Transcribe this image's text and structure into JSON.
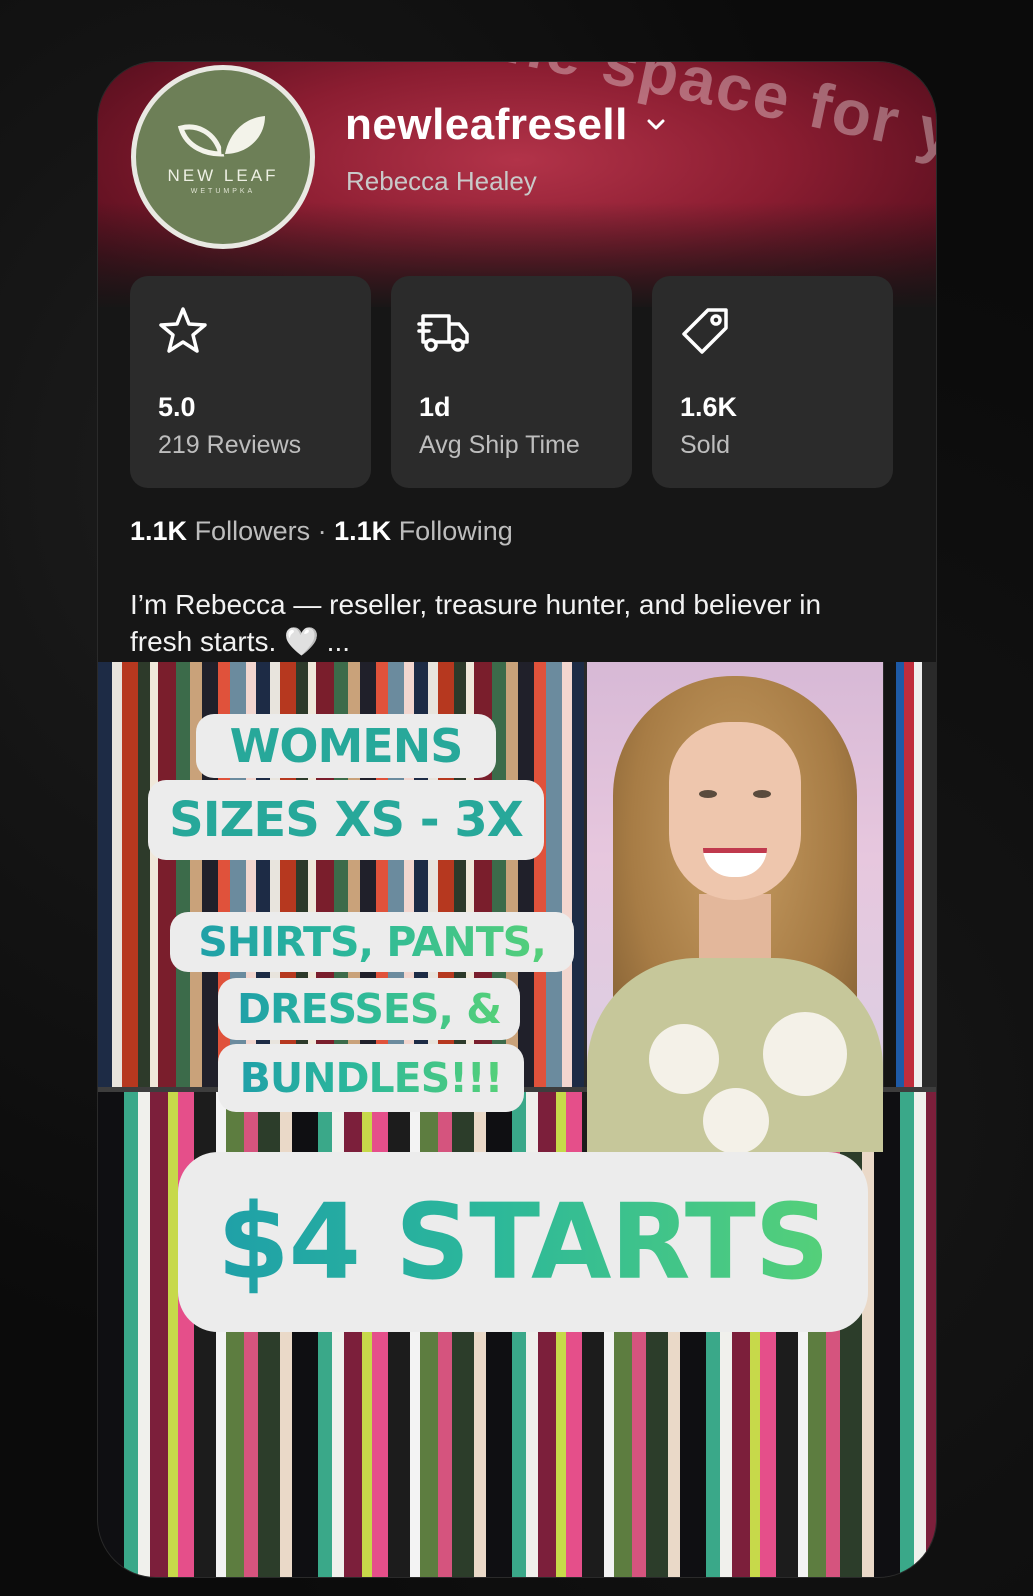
{
  "profile": {
    "username": "newleafresell",
    "real_name": "Rebecca Healey",
    "banner_text": "ice, an the space for you",
    "logo": {
      "line1": "NEW LEAF",
      "line2": "WETUMPKA"
    }
  },
  "stats": [
    {
      "icon": "star-icon",
      "value": "5.0",
      "label": "219 Reviews"
    },
    {
      "icon": "truck-icon",
      "value": "1d",
      "label": "Avg Ship Time"
    },
    {
      "icon": "tag-icon",
      "value": "1.6K",
      "label": "Sold"
    }
  ],
  "social": {
    "followers_count": "1.1K",
    "followers_label": "Followers",
    "separator": "·",
    "following_count": "1.1K",
    "following_label": "Following"
  },
  "bio": "I’m Rebecca — reseller, treasure hunter, and believer in fresh starts. 🤍 ...",
  "promo": {
    "line_women": "WOMENS",
    "line_sizes": "SIZES XS - 3X",
    "line_shirts": "SHIRTS, PANTS,",
    "line_dresses": "DRESSES, &",
    "line_bundles": "BUNDLES!!!",
    "line_price": "$4 STARTS"
  },
  "colors": {
    "banner": "#8b1d31",
    "card_bg": "#161616",
    "stat_bg": "#2b2b2b",
    "avatar_bg": "#6d7f57",
    "promo_teal": "#27a89a"
  }
}
